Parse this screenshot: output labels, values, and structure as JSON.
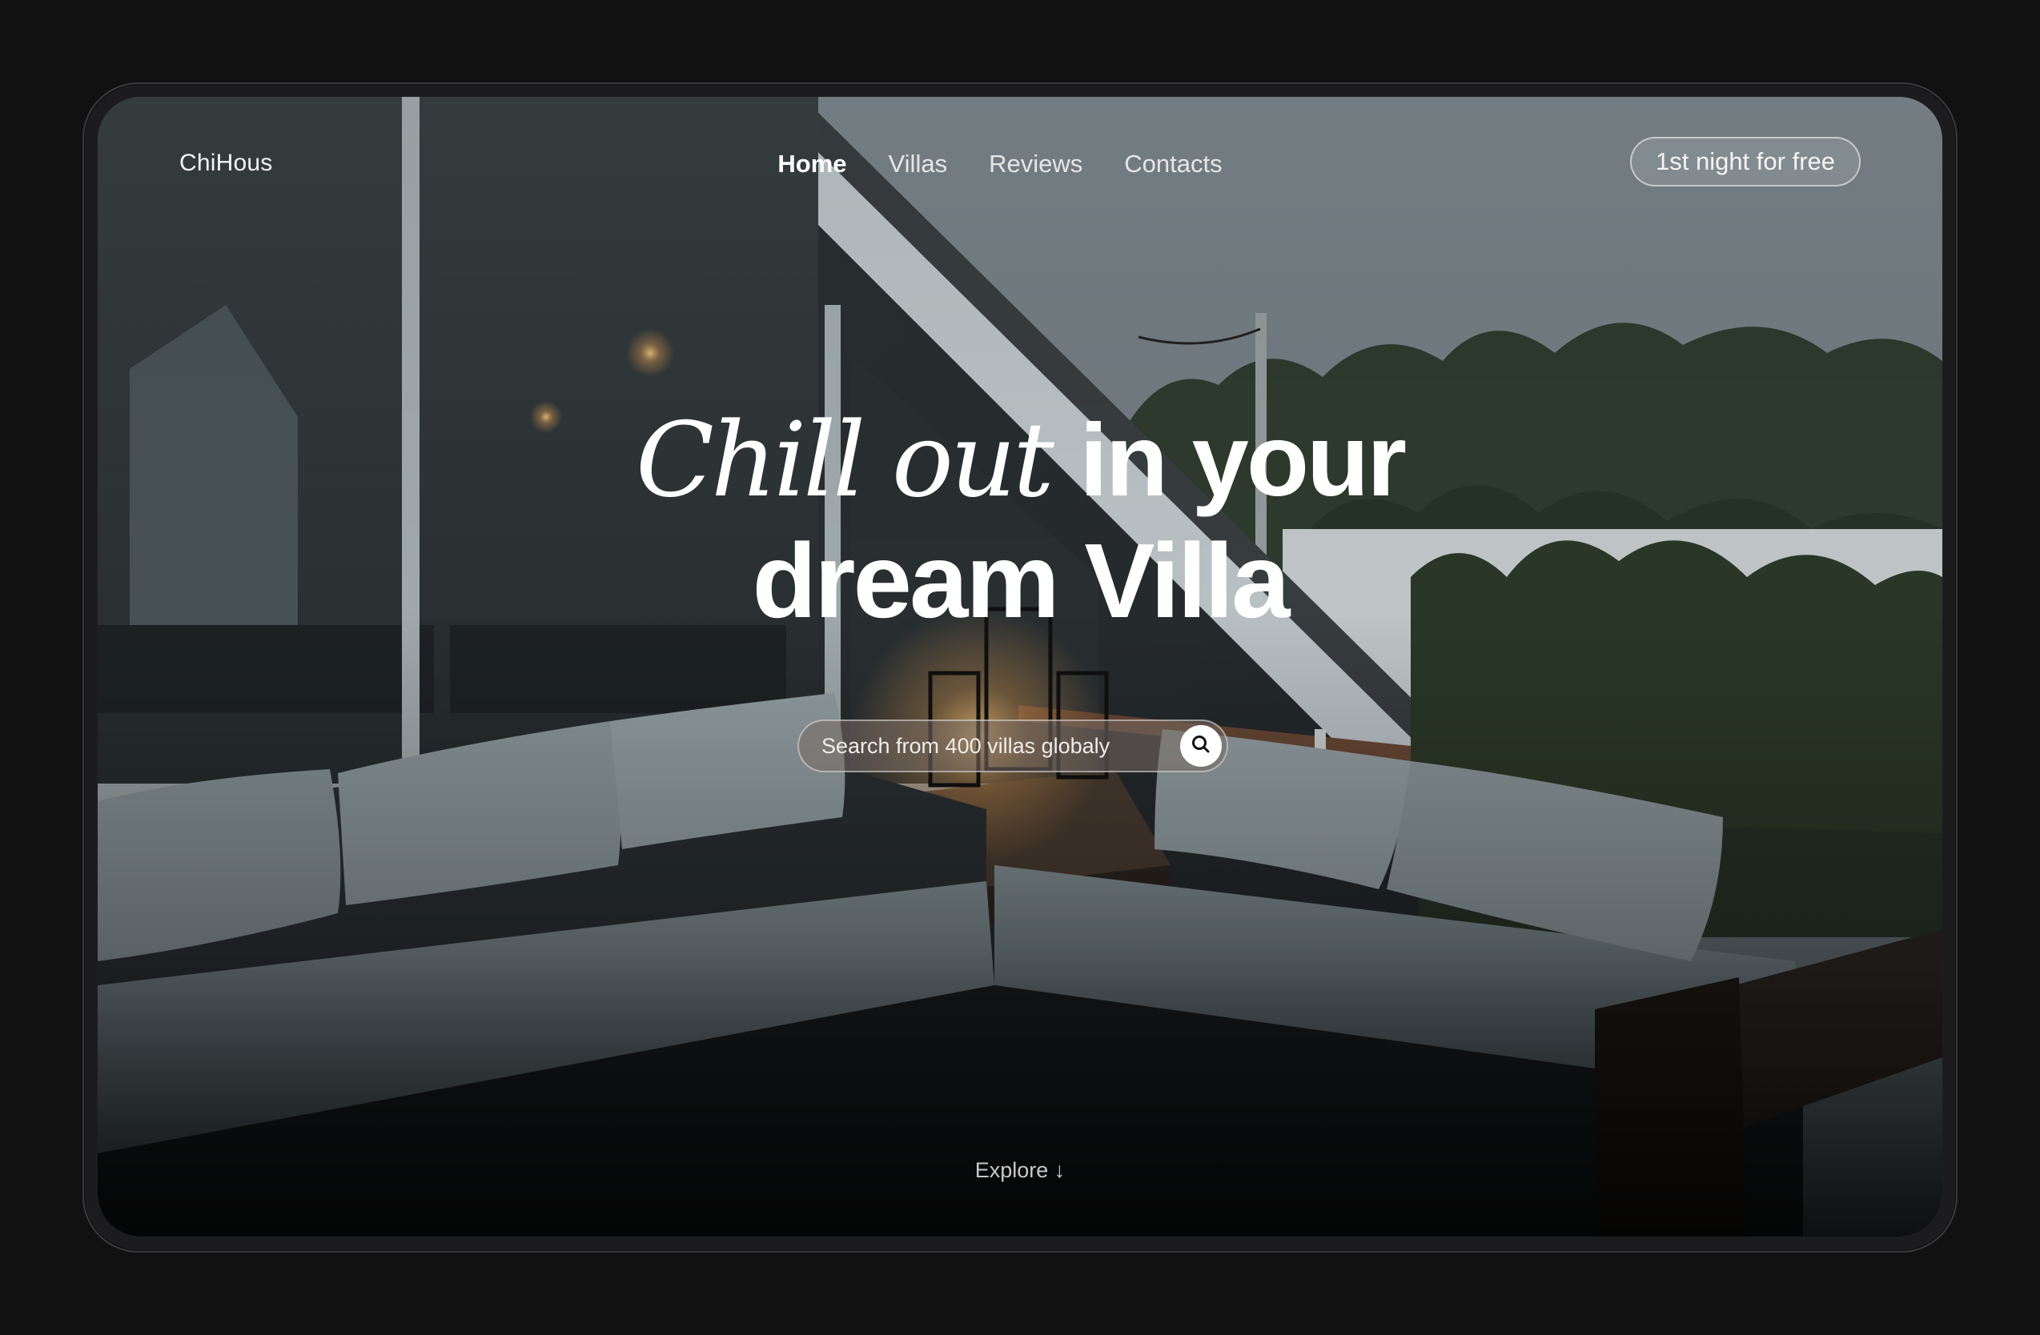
{
  "brand": {
    "logo": "ChiHous"
  },
  "nav": {
    "items": [
      {
        "label": "Home",
        "active": true
      },
      {
        "label": "Villas",
        "active": false
      },
      {
        "label": "Reviews",
        "active": false
      },
      {
        "label": "Contacts",
        "active": false
      }
    ],
    "promo_label": "1st night for free"
  },
  "hero": {
    "title_italic": "Chill out",
    "title_rest": "in your",
    "title_line2": "dream Villa"
  },
  "search": {
    "placeholder": "Search from 400 villas globaly",
    "button_icon": "search-icon"
  },
  "explore": {
    "label": "Explore",
    "arrow": "↓"
  },
  "colors": {
    "background": "#111112",
    "frame": "#1c1c1e",
    "text": "#ffffff"
  }
}
